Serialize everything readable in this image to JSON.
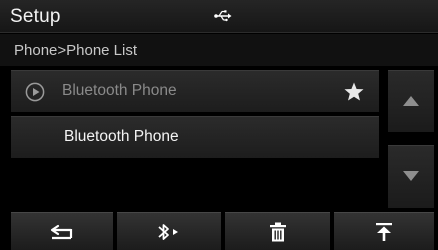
{
  "header": {
    "title": "Setup",
    "status_icon": "usb-icon"
  },
  "breadcrumb": {
    "text": "Phone>Phone List"
  },
  "list": {
    "items": [
      {
        "label": "Bluetooth Phone",
        "icon": "play-circle-icon",
        "favorite": true,
        "state": "dimmed"
      },
      {
        "label": "Bluetooth Phone",
        "state": "normal"
      }
    ]
  },
  "scroll": {
    "up_icon": "arrow-up-icon",
    "down_icon": "arrow-down-icon"
  },
  "toolbar": {
    "buttons": [
      {
        "icon": "back-icon"
      },
      {
        "icon": "bluetooth-play-icon"
      },
      {
        "icon": "trash-icon"
      },
      {
        "icon": "move-to-top-icon"
      }
    ]
  },
  "colors": {
    "background": "#000000",
    "title_bar": "#1e1e1e",
    "row": "#262626",
    "text_primary": "#f4f4f4",
    "text_dimmed": "#8a8a8a"
  }
}
